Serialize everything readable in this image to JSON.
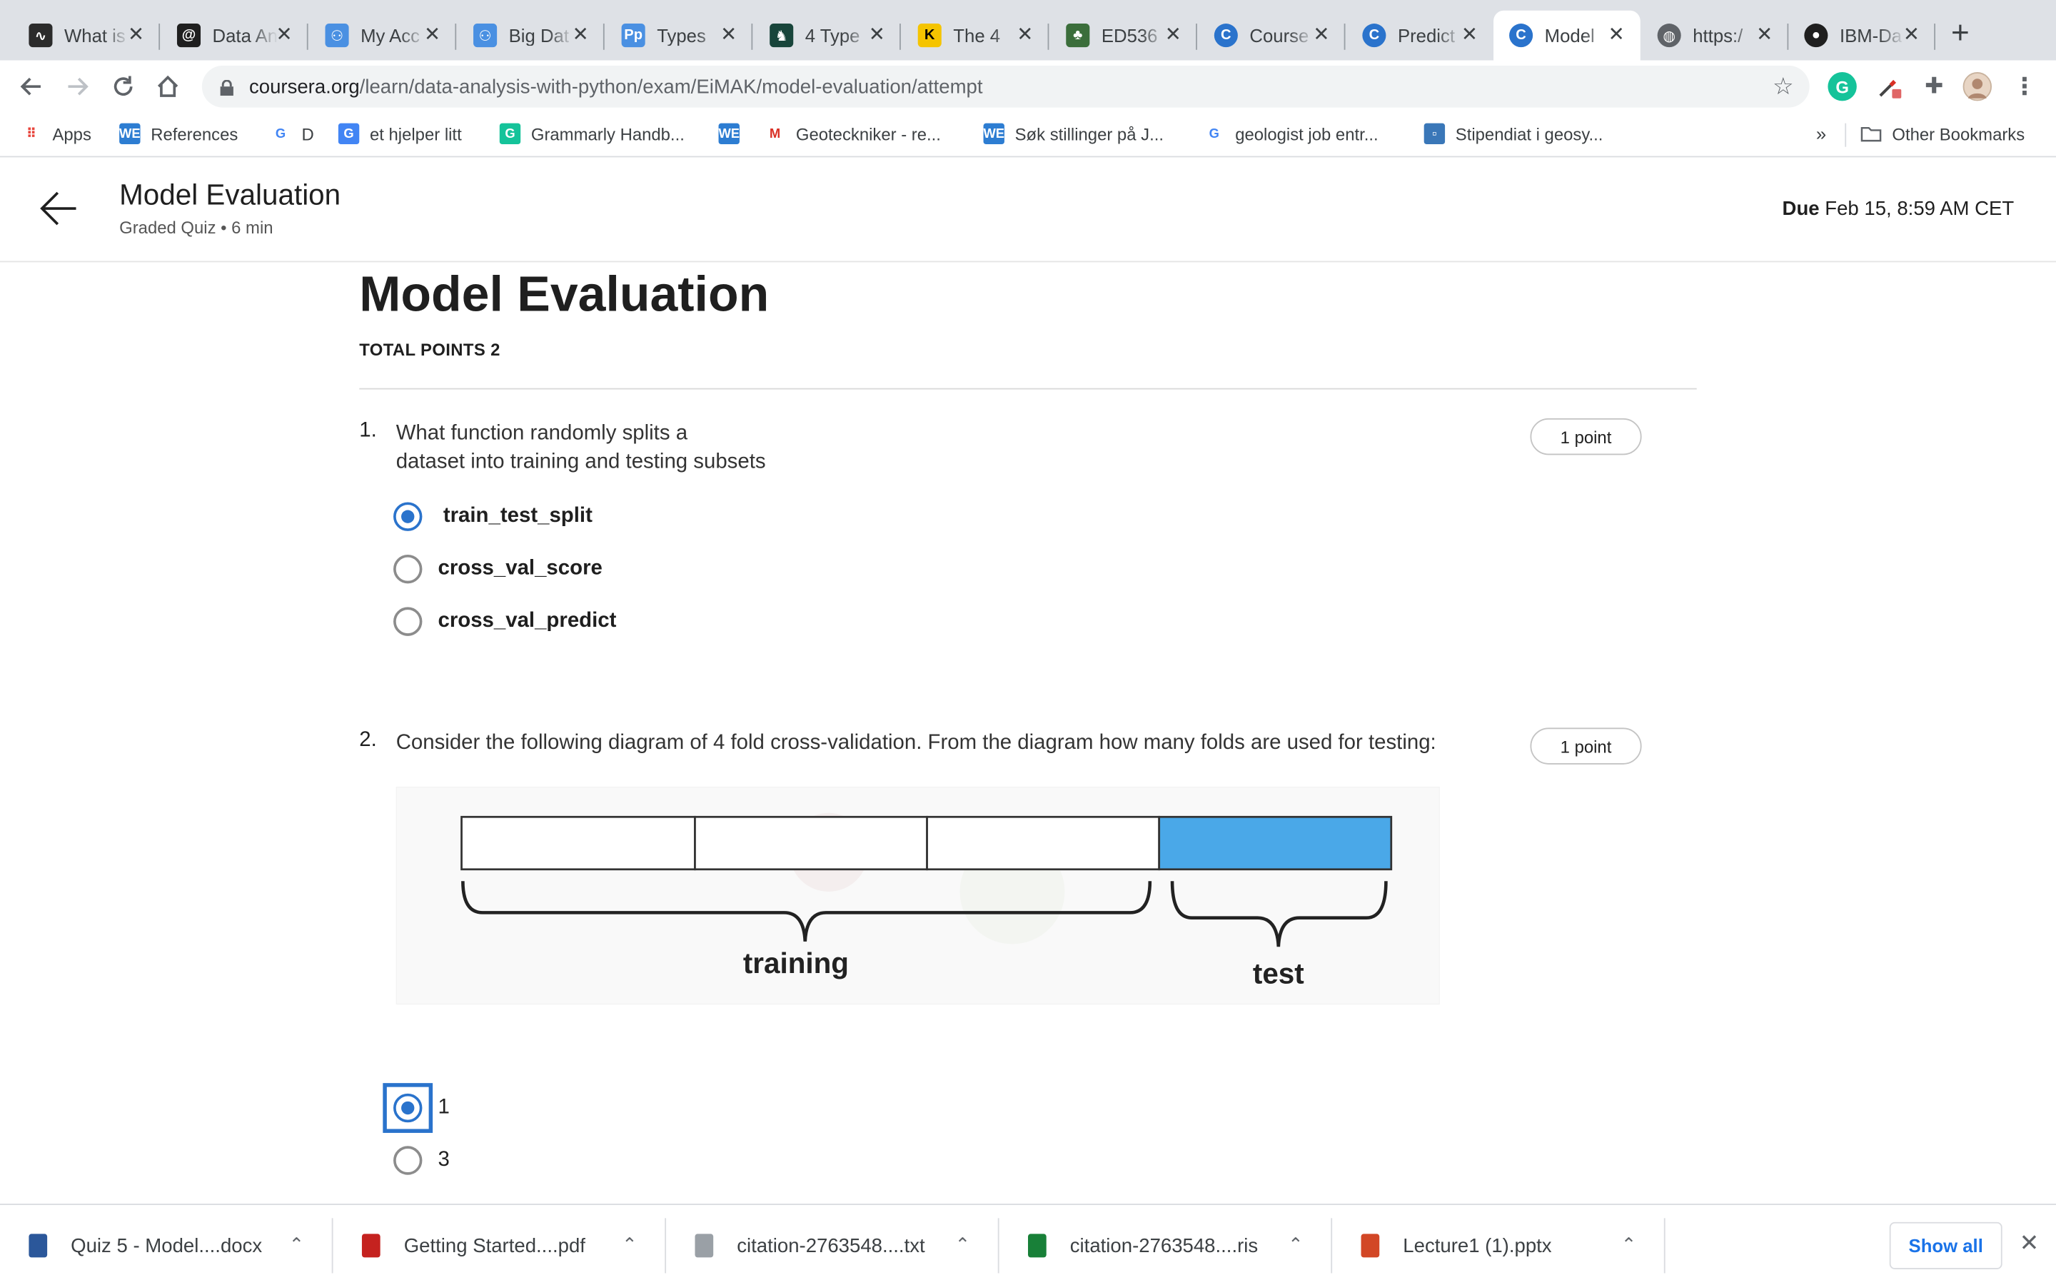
{
  "browser": {
    "tabs": [
      {
        "title": "What is",
        "icon": "activity-icon",
        "color": "#2b2b2b"
      },
      {
        "title": "Data An",
        "icon": "swirl-icon",
        "color": "#1f1f1f"
      },
      {
        "title": "My Acc",
        "icon": "people-icon",
        "color": "#4a90e2"
      },
      {
        "title": "Big Dat",
        "icon": "people-icon",
        "color": "#4a90e2"
      },
      {
        "title": "Types",
        "icon": "pp-icon",
        "color": "#4a90e2"
      },
      {
        "title": "4 Type",
        "icon": "spartan-icon",
        "color": "#18453b"
      },
      {
        "title": "The 4",
        "icon": "k-icon",
        "color": "#f5c400"
      },
      {
        "title": "ED536",
        "icon": "tree-icon",
        "color": "#3b6e3b"
      },
      {
        "title": "Course",
        "icon": "coursera-icon",
        "color": "#2a73cc"
      },
      {
        "title": "Predict",
        "icon": "coursera-icon",
        "color": "#2a73cc"
      },
      {
        "title": "Model",
        "icon": "coursera-icon",
        "color": "#2a73cc",
        "active": true
      },
      {
        "title": "https:/",
        "icon": "globe-icon",
        "color": "#5f6368"
      },
      {
        "title": "IBM-Da",
        "icon": "github-icon",
        "color": "#1f1f1f"
      }
    ],
    "url_host": "coursera.org",
    "url_path": "/learn/data-analysis-with-python/exam/EiMAK/model-evaluation/attempt",
    "bookmarks": [
      {
        "label": "Apps",
        "icon": "apps-grid-icon"
      },
      {
        "label": "References",
        "icon": "we-icon"
      },
      {
        "label": "D",
        "icon": "google-icon"
      },
      {
        "label": "et hjelper litt",
        "icon": "translate-icon"
      },
      {
        "label": "Grammarly Handb...",
        "icon": "grammarly-icon"
      },
      {
        "label": "",
        "icon": "we-icon"
      },
      {
        "label": "Geoteckniker - re...",
        "icon": "gmail-icon"
      },
      {
        "label": "Søk stillinger på J...",
        "icon": "we-icon"
      },
      {
        "label": "geologist job entr...",
        "icon": "google-icon"
      },
      {
        "label": "Stipendiat i geosy...",
        "icon": "square-icon"
      }
    ],
    "bookmarks_overflow": "»",
    "other_bookmarks": "Other Bookmarks"
  },
  "header": {
    "title": "Model Evaluation",
    "subtitle": "Graded Quiz • 6 min",
    "due_label": "Due",
    "due_value": "Feb 15, 8:59 AM CET"
  },
  "quiz": {
    "title": "Model Evaluation",
    "total_points": "TOTAL POINTS 2",
    "questions": [
      {
        "number": "1.",
        "text_line1": "What function randomly splits a",
        "text_line2": "dataset into training and testing subsets",
        "points": "1 point",
        "options": [
          "train_test_split",
          "cross_val_score",
          "cross_val_predict"
        ],
        "selected": 0
      },
      {
        "number": "2.",
        "text": "Consider the following diagram of 4 fold cross-validation. From the diagram how many folds are used for testing:",
        "points": "1 point",
        "diagram": {
          "training_label": "training",
          "test_label": "test",
          "fold_count": 4,
          "test_folds": 1,
          "test_color": "#4aa8e8"
        },
        "options": [
          "1",
          "3"
        ],
        "selected": 0
      }
    ]
  },
  "downloads": {
    "items": [
      {
        "name": "Quiz 5 - Model....docx",
        "icon": "word-file-icon",
        "color": "#2b579a"
      },
      {
        "name": "Getting Started....pdf",
        "icon": "pdf-file-icon",
        "color": "#c5221f"
      },
      {
        "name": "citation-2763548....txt",
        "icon": "text-file-icon",
        "color": "#9aa0a6"
      },
      {
        "name": "citation-2763548....ris",
        "icon": "ris-file-icon",
        "color": "#188038"
      },
      {
        "name": "Lecture1 (1).pptx",
        "icon": "ppt-file-icon",
        "color": "#d24726"
      }
    ],
    "show_all": "Show all"
  }
}
